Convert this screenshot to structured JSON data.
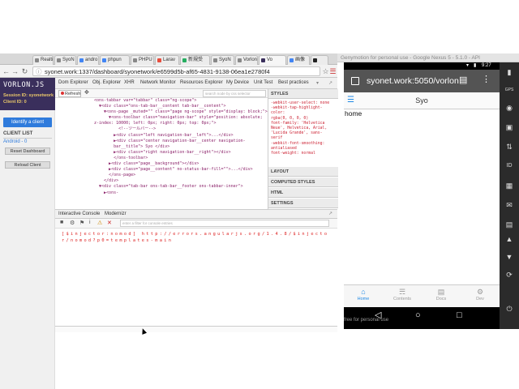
{
  "browser": {
    "tabs": [
      {
        "label": "Realti",
        "icon": "globe-icon"
      },
      {
        "label": "SyoN",
        "icon": "page-icon"
      },
      {
        "label": "andro",
        "icon": "google-icon"
      },
      {
        "label": "phpun",
        "icon": "google-icon"
      },
      {
        "label": "PHPU",
        "icon": "page-icon"
      },
      {
        "label": "Larav",
        "icon": "page-icon"
      },
      {
        "label": "新規受",
        "icon": "page-icon"
      },
      {
        "label": "SyoN",
        "icon": "page-icon"
      },
      {
        "label": "Vorlon",
        "icon": "page-icon"
      },
      {
        "label": "Vo",
        "icon": "vorlon-icon"
      },
      {
        "label": "画像",
        "icon": "google-icon"
      },
      {
        "label": "",
        "icon": "github-icon"
      }
    ],
    "url": "syonet.work:1337/dashboard/syonetwork/e6599d5b-af65-4831-9138-06ea1e2780f4"
  },
  "sidebar": {
    "logo": "VORLON.JS",
    "session_id": "Session ID: syonetwork",
    "client_id": "Client ID: 0",
    "identify_button": "Identify a client",
    "client_list_title": "CLIENT LIST",
    "client": "Android - 0",
    "reset_dashboard": "Reset Dashboard",
    "reload_client": "Reload Client"
  },
  "devtools": {
    "tabs": [
      "Dom Explorer",
      "Obj. Explorer",
      "XHR",
      "Network Monitor",
      "Resources Explorer",
      "My Device",
      "Unit Test",
      "Best practices"
    ],
    "refresh_label": "Refresh",
    "search_placeholder": "search node by css selector",
    "dom_tree": "<ons-tabbar var=\"tabbar\" class=\"ng-scope\">\n  ▼<div class=\"ons-tab-bar__content tab-bar__content\">\n    ▼<ons-page _muted=\"\" class=\"page ng-scope\" style=\"display: block;\">\n      ▼<ons-toolbar class=\"navigation-bar\" style=\"position: absolute;\nz-index: 10000; left: 0px; right: 0px; top: 0px;\">\n          <!--ツールバー-->\n        ▶<div class=\"left navigation-bar__left\">...</div>\n        ▶<div class=\"center navigation-bar__center navigation-\n        bar__title\"> Syo </div>\n        ▶<div class=\"right navigation-bar__right\"></div>\n        </ons-toolbar>\n      ▶<div class=\"page__background\"></div>\n      ▶<div class=\"page__content\" no-status-bar-fill=\"\">...</div>\n      </ons-page>\n    </div>\n  ▼<div class=\"tab-bar ons-tab-bar__footer ons-tabbar-inner\">\n    ▶<ons-",
    "styles_header": "STYLES",
    "styles": "-webkit-user-select: none\n-webkit-tap-highlight-\ncolor:\nrgba(0, 0, 0, 0)\nfont-family: 'Helvetica\nNeue', Helvetica, Arial,\n'Lucida Grande', sans-\nserif\n-webkit-font-smoothing:\nantialiased\nfont-weight: normal",
    "sections": [
      "LAYOUT",
      "COMPUTED STYLES",
      "HTML",
      "SETTINGS"
    ],
    "console_tabs": [
      "Interactive Console",
      "Modernizr"
    ],
    "filter_placeholder": "enter a filter for console entries",
    "console_error": "[$injector:nomod] http://errors.angularjs.org/1.4.8/$injector/nomod?p0=templates-main"
  },
  "emulator": {
    "window_title": "Genymotion for personal use - Google Nexus 5 - 5.1.0 - API",
    "time": "9:27",
    "mobile_url": "syonet.work:5050/vorlon",
    "toolbar_title": "Syo",
    "page_text": "home",
    "tabs": [
      {
        "label": "Home",
        "icon": "home-icon"
      },
      {
        "label": "Contents",
        "icon": "ghost-icon"
      },
      {
        "label": "Docs",
        "icon": "doc-icon"
      },
      {
        "label": "Dev",
        "icon": "gear-icon"
      }
    ],
    "footer": "free for personal use",
    "side_labels": [
      "GPS",
      "ID"
    ],
    "accent": "#1e88e5"
  }
}
